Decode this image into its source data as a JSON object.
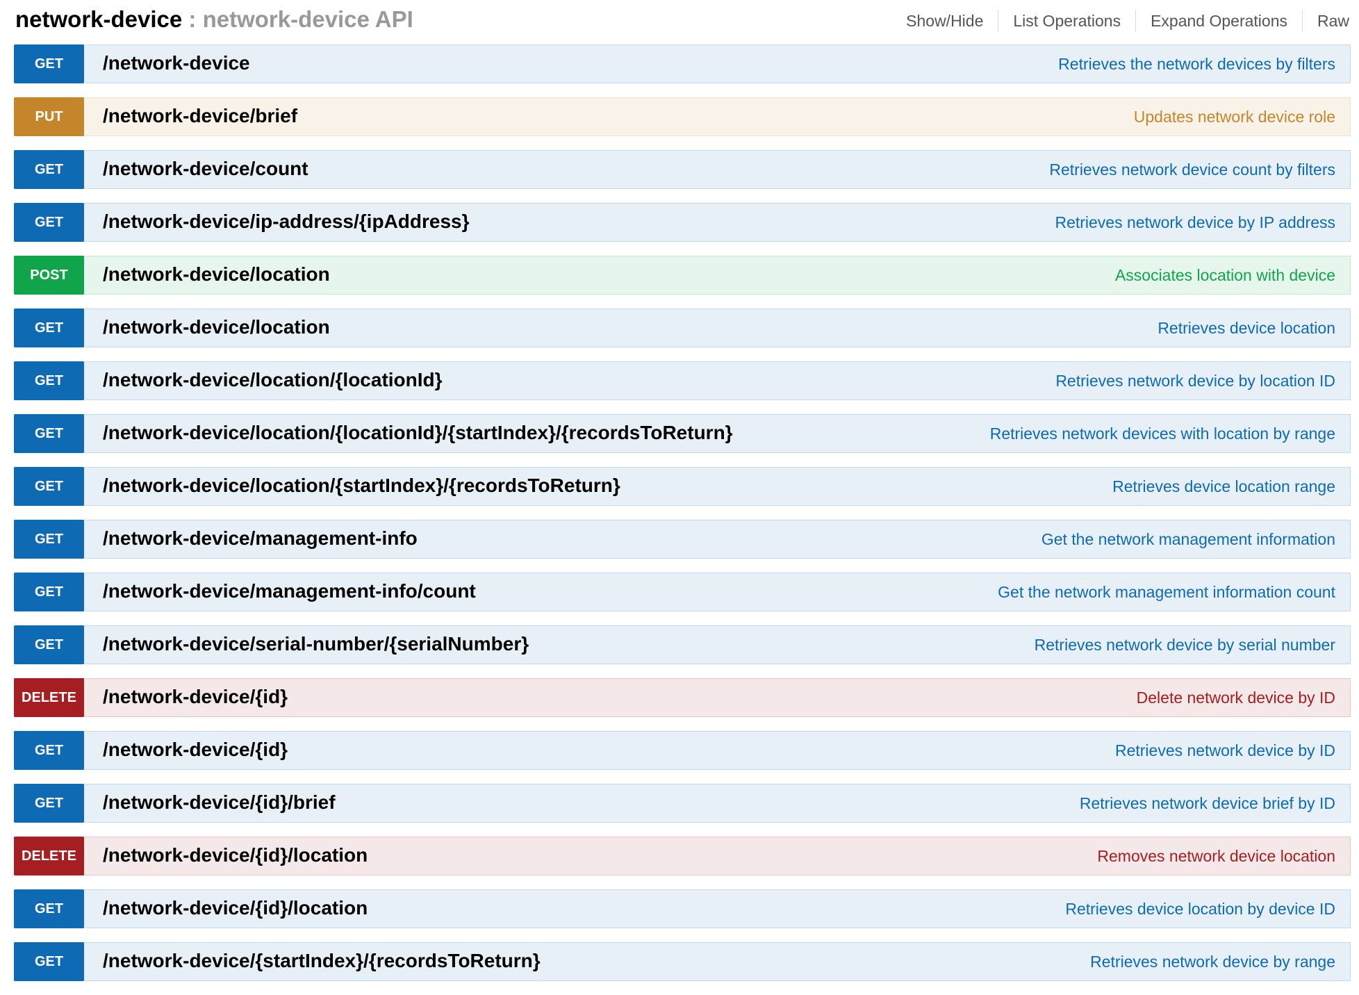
{
  "header": {
    "resource_name": "network-device",
    "separator": " : ",
    "resource_description": "network-device API",
    "links": [
      "Show/Hide",
      "List Operations",
      "Expand Operations",
      "Raw"
    ]
  },
  "colors": {
    "get": "#0f6ab4",
    "put": "#c5862b",
    "post": "#10a54a",
    "delete": "#a41e22"
  },
  "operations": [
    {
      "method": "GET",
      "path": "/network-device",
      "summary": "Retrieves the network devices by filters"
    },
    {
      "method": "PUT",
      "path": "/network-device/brief",
      "summary": "Updates network device role"
    },
    {
      "method": "GET",
      "path": "/network-device/count",
      "summary": "Retrieves network device count by filters"
    },
    {
      "method": "GET",
      "path": "/network-device/ip-address/{ipAddress}",
      "summary": "Retrieves network device by IP address"
    },
    {
      "method": "POST",
      "path": "/network-device/location",
      "summary": "Associates location with device"
    },
    {
      "method": "GET",
      "path": "/network-device/location",
      "summary": "Retrieves device location"
    },
    {
      "method": "GET",
      "path": "/network-device/location/{locationId}",
      "summary": "Retrieves network device by location ID"
    },
    {
      "method": "GET",
      "path": "/network-device/location/{locationId}/{startIndex}/{recordsToReturn}",
      "summary": "Retrieves network devices with location by range"
    },
    {
      "method": "GET",
      "path": "/network-device/location/{startIndex}/{recordsToReturn}",
      "summary": "Retrieves device location range"
    },
    {
      "method": "GET",
      "path": "/network-device/management-info",
      "summary": "Get the network management information"
    },
    {
      "method": "GET",
      "path": "/network-device/management-info/count",
      "summary": "Get the network management information count"
    },
    {
      "method": "GET",
      "path": "/network-device/serial-number/{serialNumber}",
      "summary": "Retrieves network device by serial number"
    },
    {
      "method": "DELETE",
      "path": "/network-device/{id}",
      "summary": "Delete network device by ID"
    },
    {
      "method": "GET",
      "path": "/network-device/{id}",
      "summary": "Retrieves network device by ID"
    },
    {
      "method": "GET",
      "path": "/network-device/{id}/brief",
      "summary": "Retrieves network device brief by ID"
    },
    {
      "method": "DELETE",
      "path": "/network-device/{id}/location",
      "summary": "Removes network device location"
    },
    {
      "method": "GET",
      "path": "/network-device/{id}/location",
      "summary": "Retrieves device location by device ID"
    },
    {
      "method": "GET",
      "path": "/network-device/{startIndex}/{recordsToReturn}",
      "summary": "Retrieves network device by range"
    }
  ]
}
